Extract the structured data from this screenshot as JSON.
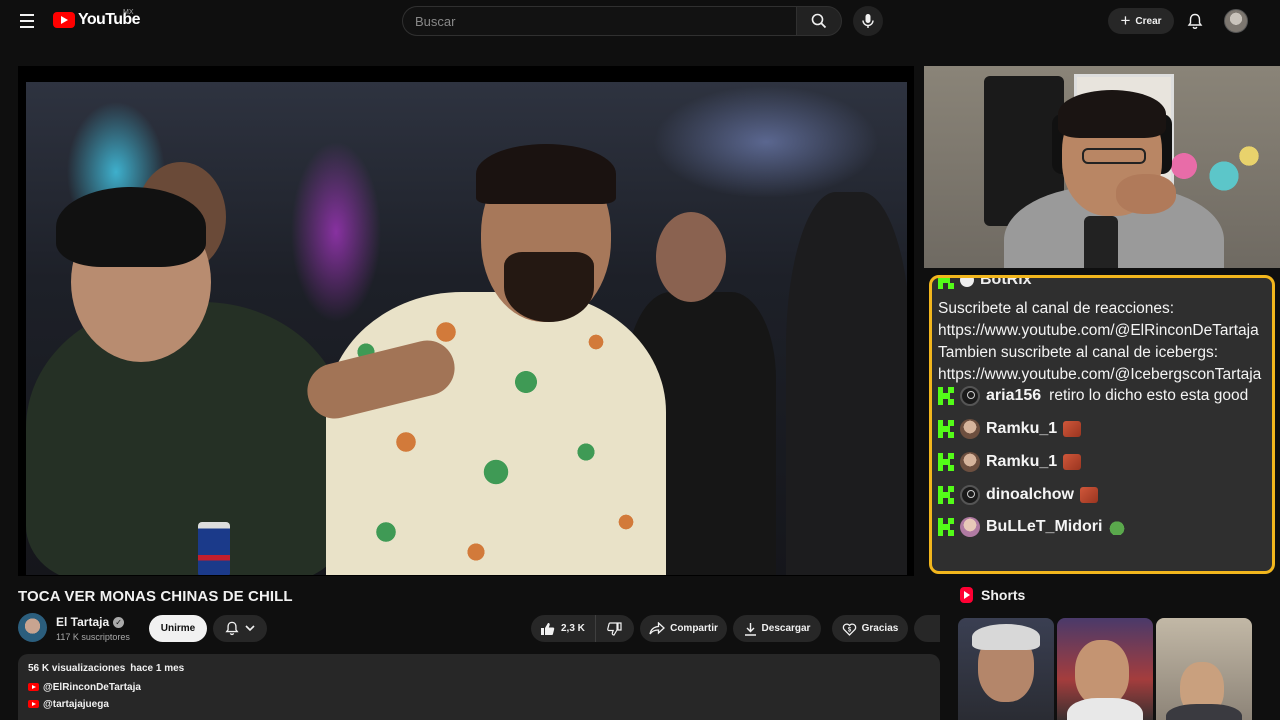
{
  "header": {
    "logo_text": "YouTube",
    "country": "MX",
    "search_placeholder": "Buscar",
    "create_label": "Crear"
  },
  "video": {
    "title": "TOCA VER MONAS CHINAS DE CHILL",
    "channel_name": "El Tartaja",
    "subscribers": "117 K suscriptores",
    "join_label": "Unirme",
    "like_count": "2,3 K",
    "share_label": "Compartir",
    "download_label": "Descargar",
    "thanks_label": "Gracias"
  },
  "description": {
    "views": "56 K visualizaciones",
    "date": "hace 1 mes",
    "links": [
      "@ElRinconDeTartaja",
      "@tartajajuega"
    ]
  },
  "chat": {
    "bot_name": "BotRix",
    "bot_message": "Suscribete al canal de reacciones: https://www.youtube.com/@ElRinconDeTartaja Tambien suscribete al canal de icebergs: https://www.youtube.com/@IcebergsconTartaja",
    "messages": [
      {
        "user": "aria156",
        "text": "retiro lo dicho esto esta good"
      },
      {
        "user": "Ramku_1",
        "text": ""
      },
      {
        "user": "Ramku_1",
        "text": ""
      },
      {
        "user": "dinoalchow",
        "text": ""
      },
      {
        "user": "BuLLeT_Midori",
        "text": ""
      }
    ]
  },
  "sidebar": {
    "shorts_title": "Shorts"
  },
  "colors": {
    "background": "#0f0f0f",
    "youtube_red": "#ff0000",
    "chat_border": "#f2b61d",
    "kick_green": "#53fc18",
    "pill_bg": "#272727"
  },
  "icons": [
    "menu-icon",
    "youtube-logo-icon",
    "search-icon",
    "mic-icon",
    "plus-icon",
    "bell-icon",
    "verified-icon",
    "chevron-down-icon",
    "like-icon",
    "dislike-icon",
    "share-icon",
    "download-icon",
    "thanks-icon",
    "shorts-icon",
    "kick-icon"
  ]
}
